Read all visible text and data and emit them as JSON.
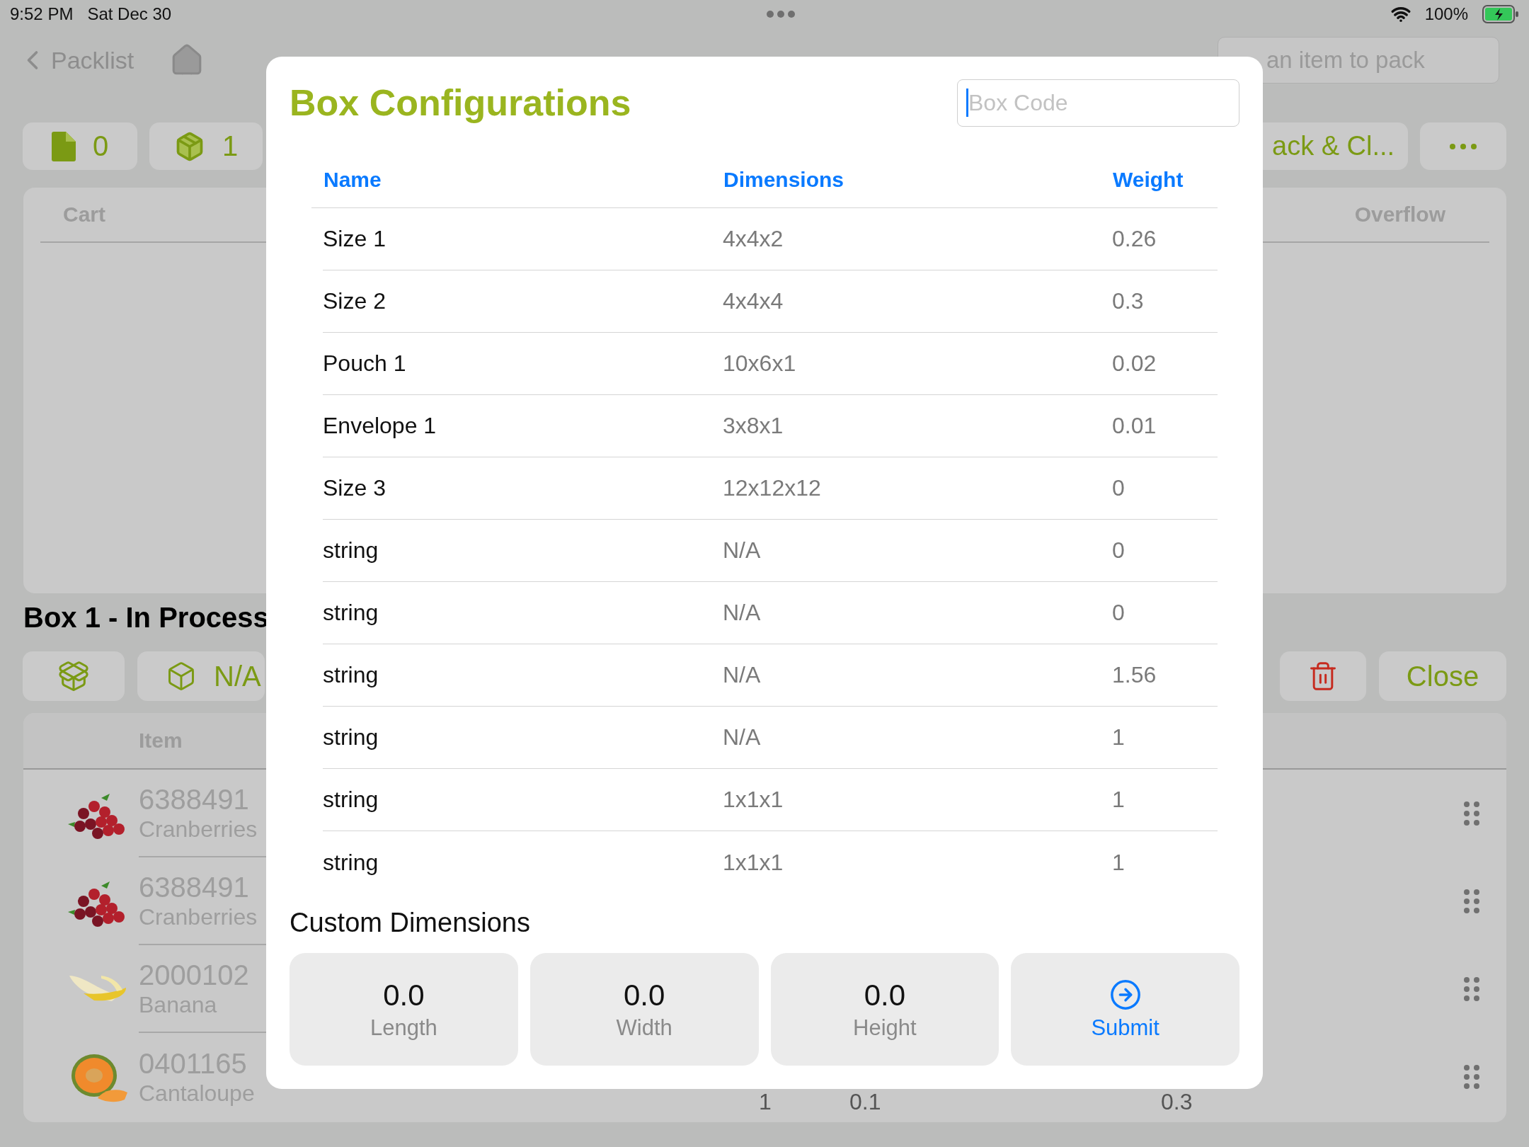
{
  "status_bar": {
    "time": "9:52 PM",
    "date": "Sat Dec 30",
    "battery": "100%"
  },
  "nav": {
    "back_label": "Packlist",
    "search": {
      "placeholder": "an item to pack"
    }
  },
  "toolbar": {
    "counters": [
      {
        "kind": "document",
        "label": "0"
      },
      {
        "kind": "package",
        "label": "1"
      }
    ],
    "pack_button": "ack & Cl..."
  },
  "cart_panel": {
    "columns": [
      "Cart",
      "Overflow"
    ]
  },
  "box": {
    "title": "Box 1 - In Process",
    "dimension_label": "N/A",
    "close_label": "Close"
  },
  "items": {
    "column": "Item",
    "rows": [
      {
        "code": "6388491",
        "name": "Cranberries"
      },
      {
        "code": "6388491",
        "name": "Cranberries"
      },
      {
        "code": "2000102",
        "name": "Banana"
      },
      {
        "code": "0401165",
        "name": "Cantaloupe",
        "column_3": "1",
        "column_4": "0.1",
        "column_5": "0.3"
      }
    ]
  },
  "modal": {
    "title": "Box Configurations",
    "box_code": {
      "placeholder": "Box Code"
    },
    "columns": [
      "Name",
      "Dimensions",
      "Weight"
    ],
    "rows": [
      [
        "Size 1",
        "4x4x2",
        "0.26"
      ],
      [
        "Size 2",
        "4x4x4",
        "0.3"
      ],
      [
        "Pouch 1",
        "10x6x1",
        "0.02"
      ],
      [
        "Envelope 1",
        "3x8x1",
        "0.01"
      ],
      [
        "Size 3",
        "12x12x12",
        "0"
      ],
      [
        "string",
        "N/A",
        "0"
      ],
      [
        "string",
        "N/A",
        "0"
      ],
      [
        "string",
        "N/A",
        "1.56"
      ],
      [
        "string",
        "N/A",
        "1"
      ],
      [
        "string",
        "1x1x1",
        "1"
      ],
      [
        "string",
        "1x1x1",
        "1"
      ]
    ],
    "custom": {
      "title": "Custom Dimensions",
      "fields": [
        {
          "value": "0.0",
          "label": "Length"
        },
        {
          "value": "0.0",
          "label": "Width"
        },
        {
          "value": "0.0",
          "label": "Height"
        }
      ],
      "submit": "Submit"
    }
  }
}
